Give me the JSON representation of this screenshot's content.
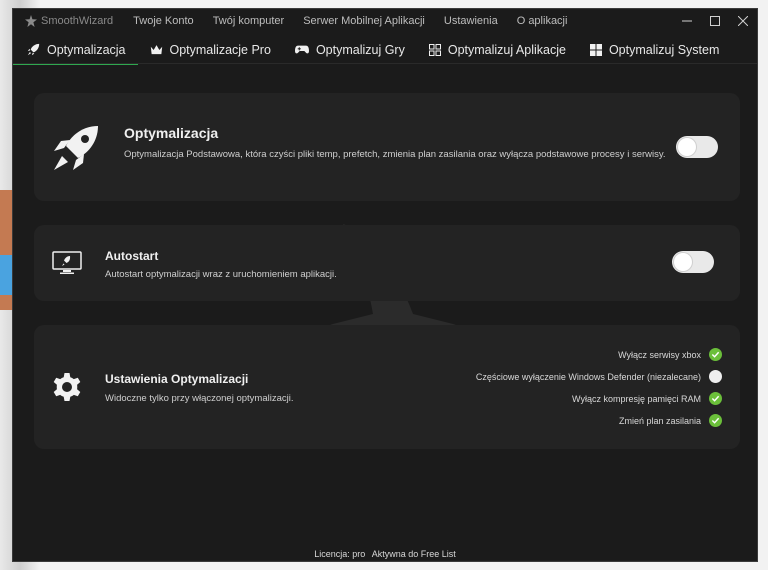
{
  "app": {
    "brand": "SmoothWizard",
    "menu": [
      "Twoje Konto",
      "Twój komputer",
      "Serwer Mobilnej Aplikacji",
      "Ustawienia",
      "O aplikacji"
    ]
  },
  "window_controls": {
    "minimize": "—",
    "maximize": "☐",
    "close": "✕"
  },
  "tabs": [
    {
      "label": "Optymalizacja",
      "icon": "rocket-icon",
      "active": true
    },
    {
      "label": "Optymalizacje Pro",
      "icon": "crown-icon",
      "active": false
    },
    {
      "label": "Optymalizuj Gry",
      "icon": "gamepad-icon",
      "active": false
    },
    {
      "label": "Optymalizuj Aplikacje",
      "icon": "apps-grid-icon",
      "active": false
    },
    {
      "label": "Optymalizuj System",
      "icon": "windows-icon",
      "active": false
    }
  ],
  "cards": {
    "optimization": {
      "title": "Optymalizacja",
      "description": "Optymalizacja Podstawowa, która czyści pliki temp, prefetch, zmienia plan zasilania oraz wyłącza podstawowe procesy i serwisy.",
      "enabled": false
    },
    "autostart": {
      "title": "Autostart",
      "description": "Autostart optymalizacji wraz z uruchomieniem aplikacji.",
      "enabled": false
    },
    "settings": {
      "title": "Ustawienia Optymalizacji",
      "description": "Widoczne tylko przy włączonej optymalizacji.",
      "options": [
        {
          "label": "Wyłącz serwisy xbox",
          "checked": true
        },
        {
          "label": "Częściowe wyłączenie Windows Defender (niezalecane)",
          "checked": false
        },
        {
          "label": "Wyłącz kompresję pamięci RAM",
          "checked": true
        },
        {
          "label": "Zmień plan zasilania",
          "checked": true
        }
      ]
    }
  },
  "status": {
    "license_label": "Licencja: pro",
    "list_label": "Aktywna do Free List"
  },
  "colors": {
    "accent": "#2fa84f",
    "check_on": "#6bbf3a",
    "background": "#1b1b1b",
    "card": "#232323"
  }
}
